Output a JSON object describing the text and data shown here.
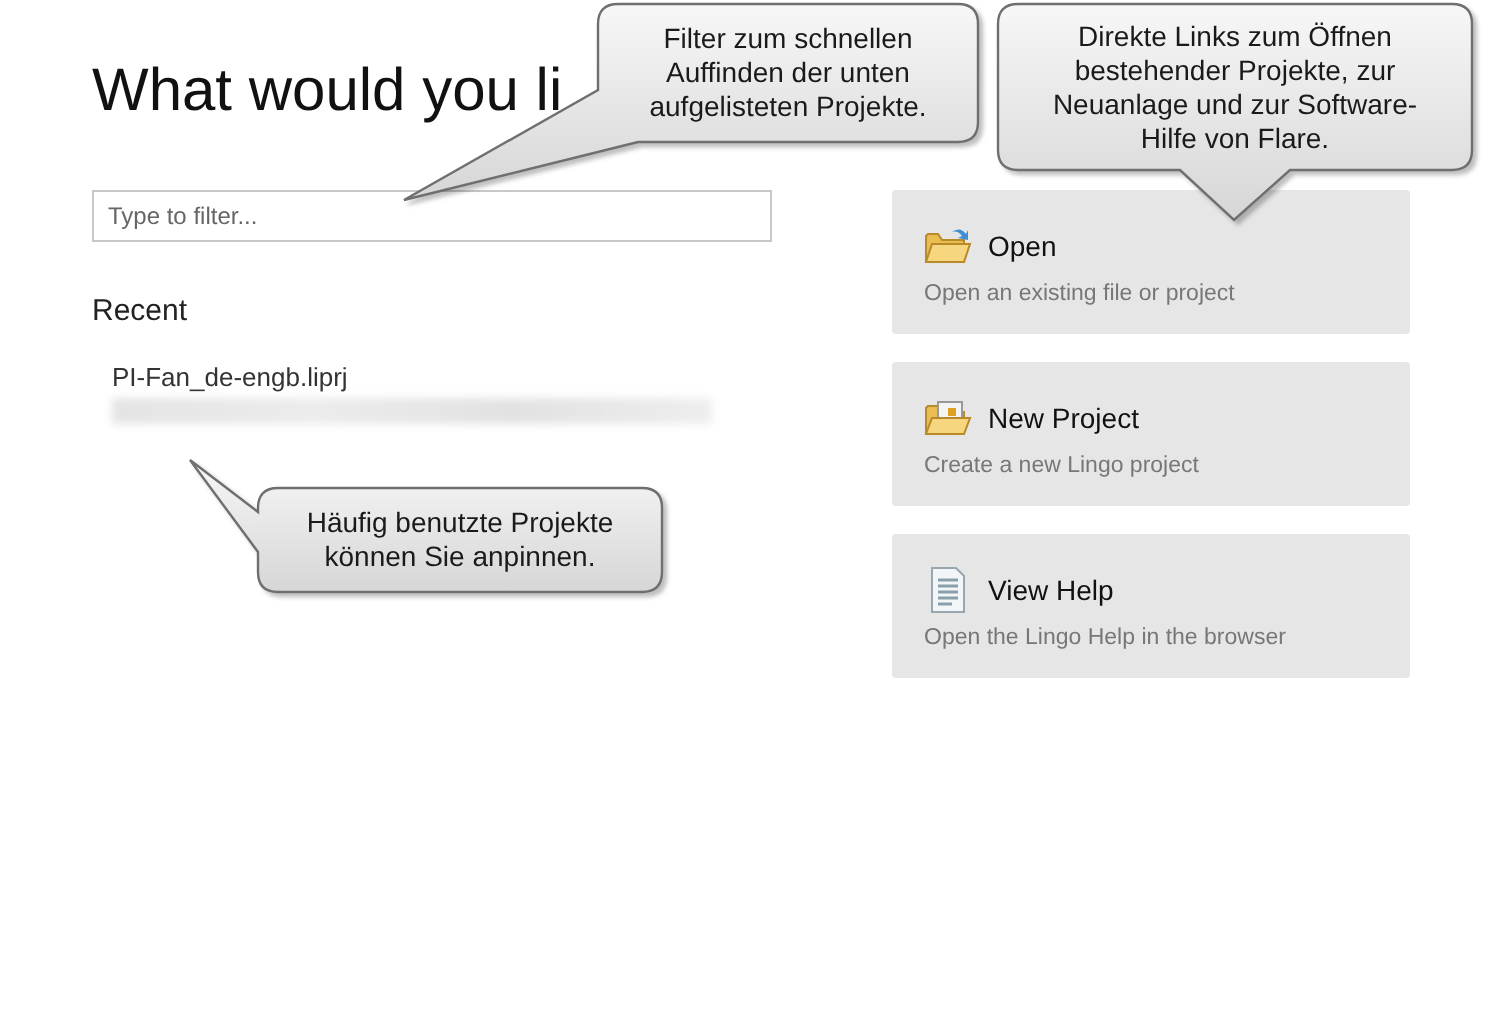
{
  "heading": "What would you li",
  "filter": {
    "placeholder": "Type to filter..."
  },
  "recent": {
    "title": "Recent",
    "items": [
      {
        "name": "PI-Fan_de-engb.liprj"
      }
    ]
  },
  "actions": [
    {
      "kind": "open",
      "title": "Open",
      "description": "Open an existing file or project"
    },
    {
      "kind": "new",
      "title": "New Project",
      "description": "Create a new Lingo project"
    },
    {
      "kind": "help",
      "title": "View Help",
      "description": "Open the Lingo Help in the browser"
    }
  ],
  "callouts": [
    {
      "text": "Filter zum schnellen Auffinden der unten aufgelisteten Projekte."
    },
    {
      "text": "Direkte Links zum Öffnen bestehender Projekte, zur Neuanlage und zur Software-Hilfe von Flare."
    },
    {
      "text": "Häufig benutzte Projekte können Sie anpinnen."
    }
  ]
}
